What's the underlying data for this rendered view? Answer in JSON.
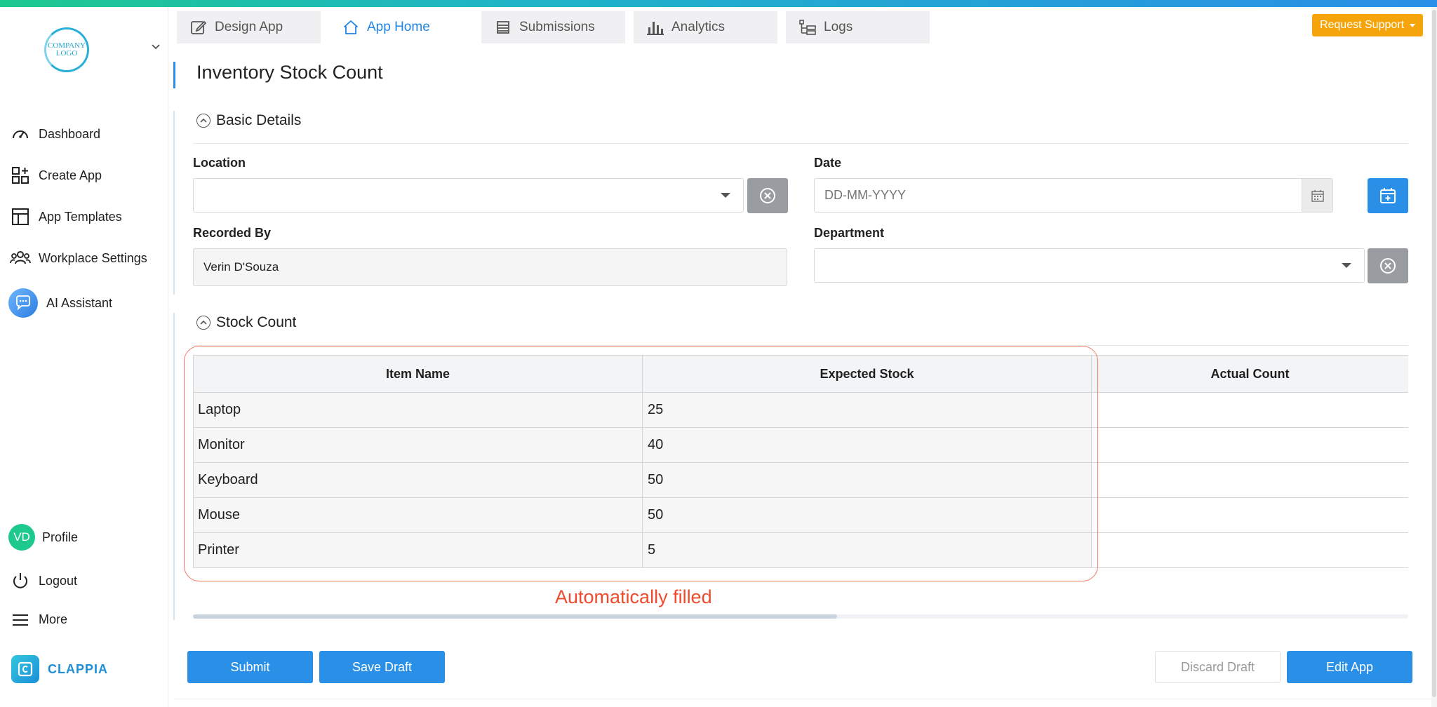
{
  "sidebar": {
    "logo_text_line1": "COMPANY",
    "logo_text_line2": "LOGO",
    "items": [
      {
        "label": "Dashboard"
      },
      {
        "label": "Create App"
      },
      {
        "label": "App Templates"
      },
      {
        "label": "Workplace Settings"
      },
      {
        "label": "AI Assistant"
      }
    ],
    "bottom_items": [
      {
        "label": "Profile",
        "avatar_initials": "VD"
      },
      {
        "label": "Logout"
      },
      {
        "label": "More"
      }
    ],
    "brand": "CLAPPIA"
  },
  "tabs": [
    {
      "label": "Design App",
      "icon": "edit-icon"
    },
    {
      "label": "App Home",
      "icon": "home-icon",
      "active": true
    },
    {
      "label": "Submissions",
      "icon": "list-icon"
    },
    {
      "label": "Analytics",
      "icon": "bar-chart-icon"
    },
    {
      "label": "Logs",
      "icon": "logs-icon"
    }
  ],
  "request_support": "Request Support",
  "form": {
    "title": "Inventory Stock Count",
    "sections": {
      "basic": "Basic Details",
      "stock": "Stock Count"
    },
    "fields": {
      "location_label": "Location",
      "location_value": "",
      "date_label": "Date",
      "date_placeholder": "DD-MM-YYYY",
      "recorded_by_label": "Recorded By",
      "recorded_by_value": "Verin D'Souza",
      "department_label": "Department",
      "department_value": ""
    },
    "table": {
      "headers": [
        "Item Name",
        "Expected Stock",
        "Actual Count"
      ],
      "rows": [
        [
          "Laptop",
          "25",
          ""
        ],
        [
          "Monitor",
          "40",
          ""
        ],
        [
          "Keyboard",
          "50",
          ""
        ],
        [
          "Mouse",
          "50",
          ""
        ],
        [
          "Printer",
          "5",
          ""
        ]
      ]
    },
    "annotation": "Automatically filled"
  },
  "buttons": {
    "submit": "Submit",
    "save_draft": "Save Draft",
    "discard_draft": "Discard Draft",
    "edit_app": "Edit App"
  },
  "colors": {
    "accent": "#2a8fe6",
    "support": "#f5a50b",
    "annotation": "#f04a2e",
    "profile_avatar": "#1ec98e"
  }
}
